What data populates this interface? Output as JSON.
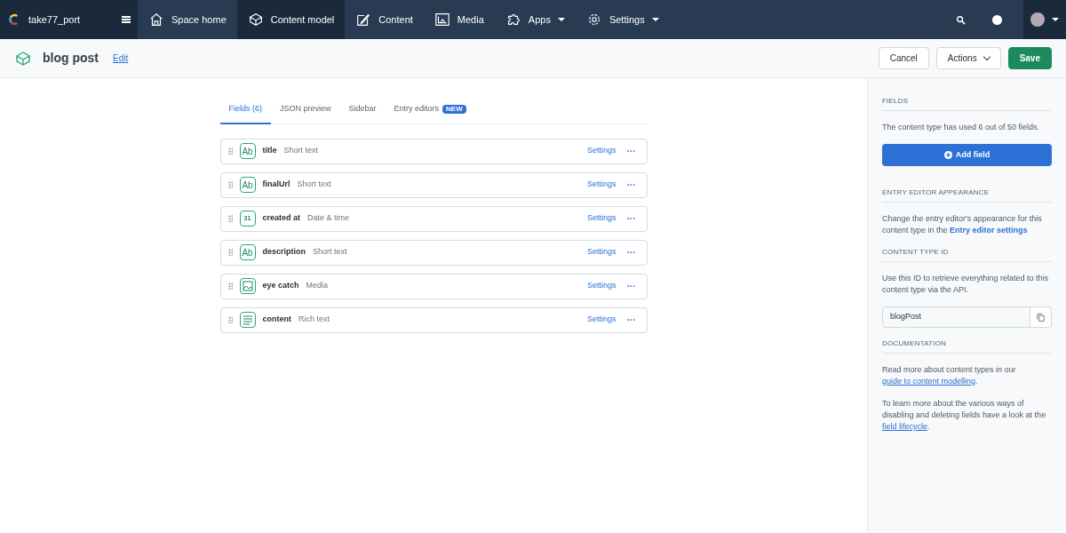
{
  "topbar": {
    "space_name": "take77_port",
    "nav": [
      {
        "label": "Space home",
        "selected": false,
        "dropdown": false
      },
      {
        "label": "Content model",
        "selected": true,
        "dropdown": false
      },
      {
        "label": "Content",
        "selected": false,
        "dropdown": false
      },
      {
        "label": "Media",
        "selected": false,
        "dropdown": false
      },
      {
        "label": "Apps",
        "selected": false,
        "dropdown": true
      },
      {
        "label": "Settings",
        "selected": false,
        "dropdown": true
      }
    ]
  },
  "header": {
    "title": "blog post",
    "edit_link": "Edit",
    "buttons": [
      {
        "label": "Cancel",
        "kind": "secondary"
      },
      {
        "label": "Actions",
        "kind": "dropdown"
      },
      {
        "label": "Save",
        "kind": "primary"
      }
    ]
  },
  "tabs": [
    {
      "label": "Fields (6)",
      "selected": true
    },
    {
      "label": "JSON preview",
      "selected": false
    },
    {
      "label": "Sidebar",
      "selected": false
    },
    {
      "label": "Entry editors",
      "selected": false,
      "badge": "NEW"
    }
  ],
  "fields": [
    {
      "name": "title",
      "type": "Short text",
      "kind": "text",
      "icon_label": "Ab",
      "settings": "Settings",
      "more": "···"
    },
    {
      "name": "finalUrl",
      "type": "Short text",
      "kind": "text",
      "icon_label": "Ab",
      "settings": "Settings",
      "more": "···"
    },
    {
      "name": "created at",
      "type": "Date & time",
      "kind": "date",
      "icon_label": "31",
      "settings": "Settings",
      "more": "···"
    },
    {
      "name": "description",
      "type": "Short text",
      "kind": "text",
      "icon_label": "Ab",
      "settings": "Settings",
      "more": "···"
    },
    {
      "name": "eye catch",
      "type": "Media",
      "kind": "media",
      "settings": "Settings",
      "more": "···"
    },
    {
      "name": "content",
      "type": "Rich text",
      "kind": "richtext",
      "settings": "Settings",
      "more": "···"
    }
  ],
  "sidebar": {
    "sections": [
      {
        "heading": "FIELDS",
        "paragraphs": [
          {
            "text": "The content type has used 6 out of 50 fields."
          }
        ],
        "button": "Add field"
      },
      {
        "heading": "ENTRY EDITOR APPEARANCE",
        "paragraphs": [
          {
            "text": "Change the entry editor's appearance for this content type in the ",
            "link": "Entry editor settings",
            "kind": "settings"
          }
        ]
      },
      {
        "heading": "CONTENT TYPE ID",
        "paragraphs": [
          {
            "text": "Use this ID to retrieve everything related to this content type via the API."
          }
        ],
        "id_value": "blogPost"
      },
      {
        "heading": "DOCUMENTATION",
        "paragraphs": [
          {
            "text": "Read more about content types in our ",
            "link": "guide to content modelling",
            "after": ".",
            "kind": "doc"
          },
          {
            "text": "To learn more about the various ways of disabling and deleting fields have a look at the ",
            "link": "field lifecycle",
            "after": ".",
            "kind": "doc"
          }
        ]
      }
    ]
  }
}
